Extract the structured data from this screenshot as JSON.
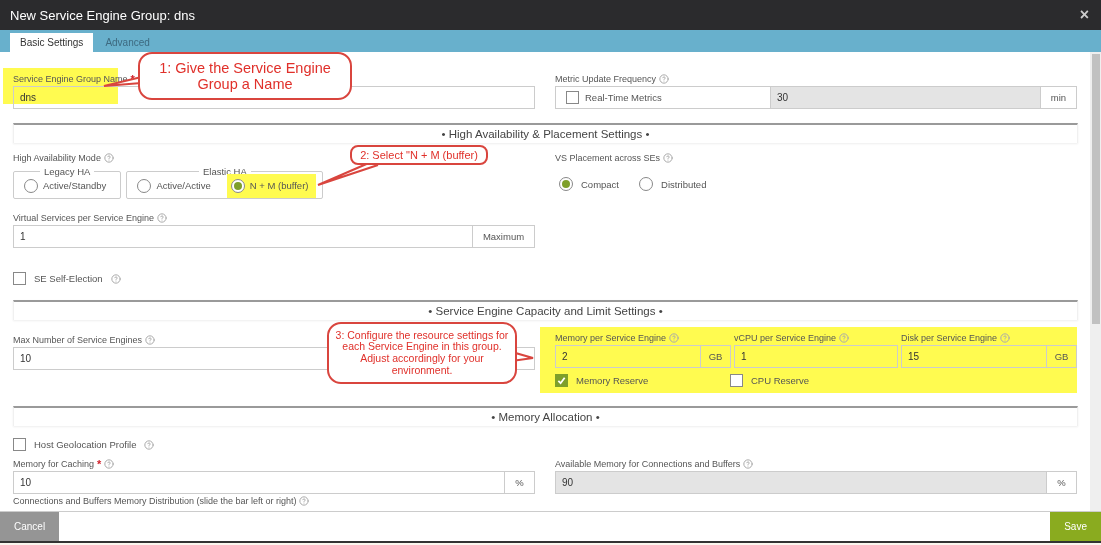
{
  "window": {
    "title": "New Service Engine Group: dns",
    "close": "×"
  },
  "tabs": [
    {
      "label": "Basic Settings",
      "selected": true
    },
    {
      "label": "Advanced",
      "selected": false
    }
  ],
  "general": {
    "name_field": {
      "label": "Service Engine Group Name",
      "required_mark": "*",
      "value": "dns",
      "highlighted": true
    },
    "metric_update": {
      "label": "Metric Update Frequency",
      "checkbox_label": "Real-Time Metrics",
      "checked": false,
      "value": "30",
      "unit": "min",
      "disabled": true
    }
  },
  "ha_section": {
    "title": "• High Availability & Placement Settings •",
    "ha_mode": {
      "label": "High Availability Mode",
      "groups": [
        {
          "legend": "Legacy HA",
          "options": [
            {
              "label": "Active/Standby",
              "selected": false,
              "highlighted": false
            }
          ]
        },
        {
          "legend": "Elastic HA",
          "options": [
            {
              "label": "Active/Active",
              "selected": false,
              "highlighted": false
            },
            {
              "label": "N + M (buffer)",
              "selected": true,
              "highlighted": true
            }
          ]
        }
      ]
    },
    "vs_placement": {
      "label": "VS Placement across SEs",
      "options": [
        {
          "label": "Compact",
          "selected": true
        },
        {
          "label": "Distributed",
          "selected": false
        }
      ]
    },
    "vs_per_se": {
      "label": "Virtual Services per Service Engine",
      "value": "1",
      "unit": "Maximum"
    },
    "self_election": {
      "label": "SE Self-Election",
      "checked": false
    }
  },
  "capacity_section": {
    "title": "• Service Engine Capacity and Limit Settings •",
    "max_se": {
      "label": "Max Number of Service Engines",
      "value": "10"
    },
    "resources": {
      "highlighted": true,
      "fields": [
        {
          "label": "Memory per Service Engine",
          "value": "2",
          "unit": "GB"
        },
        {
          "label": "vCPU per Service Engine",
          "value": "1"
        },
        {
          "label": "Disk per Service Engine",
          "value": "15",
          "unit": "GB"
        }
      ],
      "checkboxes": [
        {
          "label": "Memory Reserve",
          "checked": true
        },
        {
          "label": "CPU Reserve",
          "checked": false
        }
      ]
    }
  },
  "memory_section": {
    "title": "• Memory Allocation •",
    "host_geo": {
      "label": "Host Geolocation Profile",
      "checked": false
    },
    "caching": {
      "label": "Memory for Caching",
      "required_mark": "*",
      "value": "10",
      "unit": "%"
    },
    "available": {
      "label": "Available Memory for Connections and Buffers",
      "value": "90",
      "unit": "%",
      "disabled": true
    },
    "distribution_label": "Connections and Buffers Memory Distribution (slide the bar left or right)"
  },
  "footer": {
    "cancel": "Cancel",
    "save": "Save"
  },
  "callouts": [
    {
      "text": "1: Give the Service Engine Group a Name"
    },
    {
      "text": "2: Select \"N + M (buffer)"
    },
    {
      "text": "3: Configure the resource settings for each Service Engine in this group.  Adjust accordingly for your environment."
    }
  ]
}
